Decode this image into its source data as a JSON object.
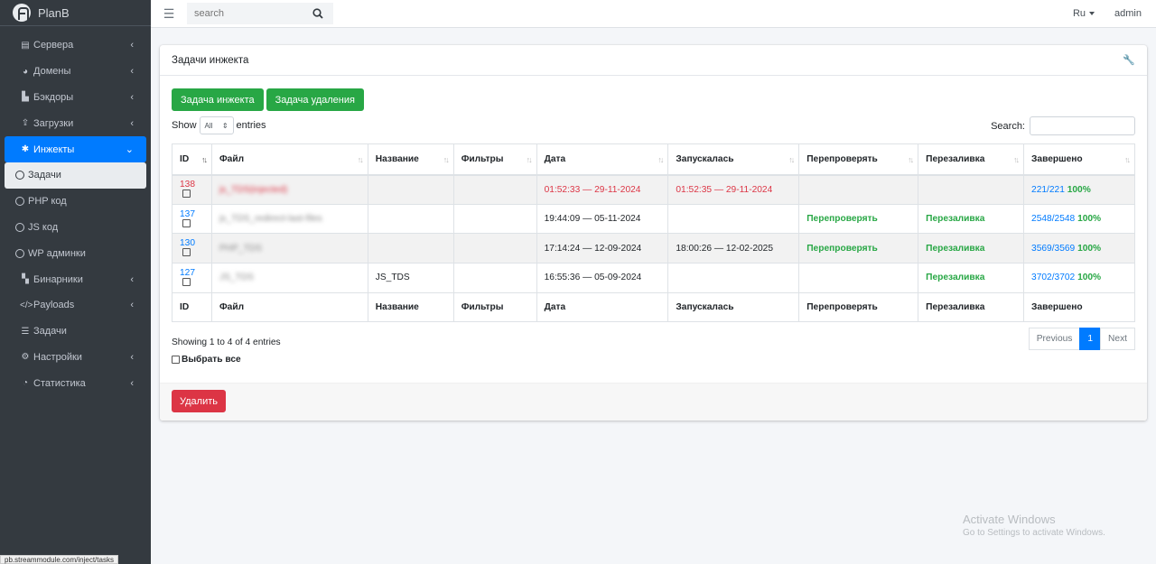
{
  "brand": {
    "name": "PlanB"
  },
  "sidebar": {
    "items": [
      {
        "label": "Сервера",
        "icon": "server-icon",
        "glyph": "▤",
        "arrow": true
      },
      {
        "label": "Домены",
        "icon": "globe-icon",
        "glyph": "◕",
        "arrow": true
      },
      {
        "label": "Бэкдоры",
        "icon": "door-icon",
        "glyph": "▙",
        "arrow": true
      },
      {
        "label": "Загрузки",
        "icon": "upload-icon",
        "glyph": "⇪",
        "arrow": true
      },
      {
        "label": "Инжекты",
        "icon": "bug-icon",
        "glyph": "✱",
        "arrow": true,
        "active": true
      },
      {
        "label": "Задачи",
        "icon": "circle-icon",
        "sub": true,
        "subActive": true
      },
      {
        "label": "PHP код",
        "icon": "circle-icon",
        "sub": true
      },
      {
        "label": "JS код",
        "icon": "circle-icon",
        "sub": true
      },
      {
        "label": "WP админки",
        "icon": "circle-icon",
        "sub": true
      },
      {
        "label": "Бинарники",
        "icon": "file-icon",
        "glyph": "▚",
        "arrow": true
      },
      {
        "label": "Payloads",
        "icon": "code-icon",
        "glyph": "</>",
        "arrow": true
      },
      {
        "label": "Задачи",
        "icon": "tasks-icon",
        "glyph": "☰",
        "arrow": false
      },
      {
        "label": "Настройки",
        "icon": "gears-icon",
        "glyph": "⚙",
        "arrow": true
      },
      {
        "label": "Статистика",
        "icon": "pie-chart-icon",
        "glyph": "◔",
        "arrow": true
      }
    ]
  },
  "topbar": {
    "search_placeholder": "search",
    "lang": "Ru",
    "user": "admin"
  },
  "card": {
    "title": "Задачи инжекта",
    "btn_inject": "Задача инжекта",
    "btn_delete_task": "Задача удаления",
    "show_label": "Show",
    "show_value": "All",
    "entries_label": "entries",
    "search_label": "Search:"
  },
  "table": {
    "columns": [
      "ID",
      "Файл",
      "Название",
      "Фильтры",
      "Дата",
      "Запускалась",
      "Перепроверять",
      "Перезаливка",
      "Завершено"
    ],
    "rows": [
      {
        "id": "138",
        "file": "js_TDS(injected)",
        "name": "",
        "filters": "",
        "date": "01:52:33 — 29-11-2024",
        "started": "01:52:35 — 29-11-2024",
        "recheck": "",
        "reupload": "",
        "done": "221/221",
        "pct": "100%",
        "error": true
      },
      {
        "id": "137",
        "file": "js_TDS_redirect-last-files",
        "name": "",
        "filters": "",
        "date": "19:44:09 — 05-11-2024",
        "started": "",
        "recheck": "Перепроверять",
        "reupload": "Перезаливка",
        "done": "2548/2548",
        "pct": "100%"
      },
      {
        "id": "130",
        "file": "PHP_TDS",
        "name": "",
        "filters": "",
        "date": "17:14:24 — 12-09-2024",
        "started": "18:00:26 — 12-02-2025",
        "recheck": "Перепроверять",
        "reupload": "Перезаливка",
        "done": "3569/3569",
        "pct": "100%"
      },
      {
        "id": "127",
        "file": "JS_TDS",
        "name": "JS_TDS",
        "filters": "",
        "date": "16:55:36 — 05-09-2024",
        "started": "",
        "recheck": "",
        "reupload": "Перезаливка",
        "done": "3702/3702",
        "pct": "100%"
      }
    ]
  },
  "footer": {
    "info": "Showing 1 to 4 of 4 entries",
    "select_all": "Выбрать все",
    "prev": "Previous",
    "page": "1",
    "next": "Next",
    "delete": "Удалить"
  },
  "watermark": {
    "line1": "Activate Windows",
    "line2": "Go to Settings to activate Windows."
  },
  "status_url": "pb.streammodule.com/inject/tasks"
}
